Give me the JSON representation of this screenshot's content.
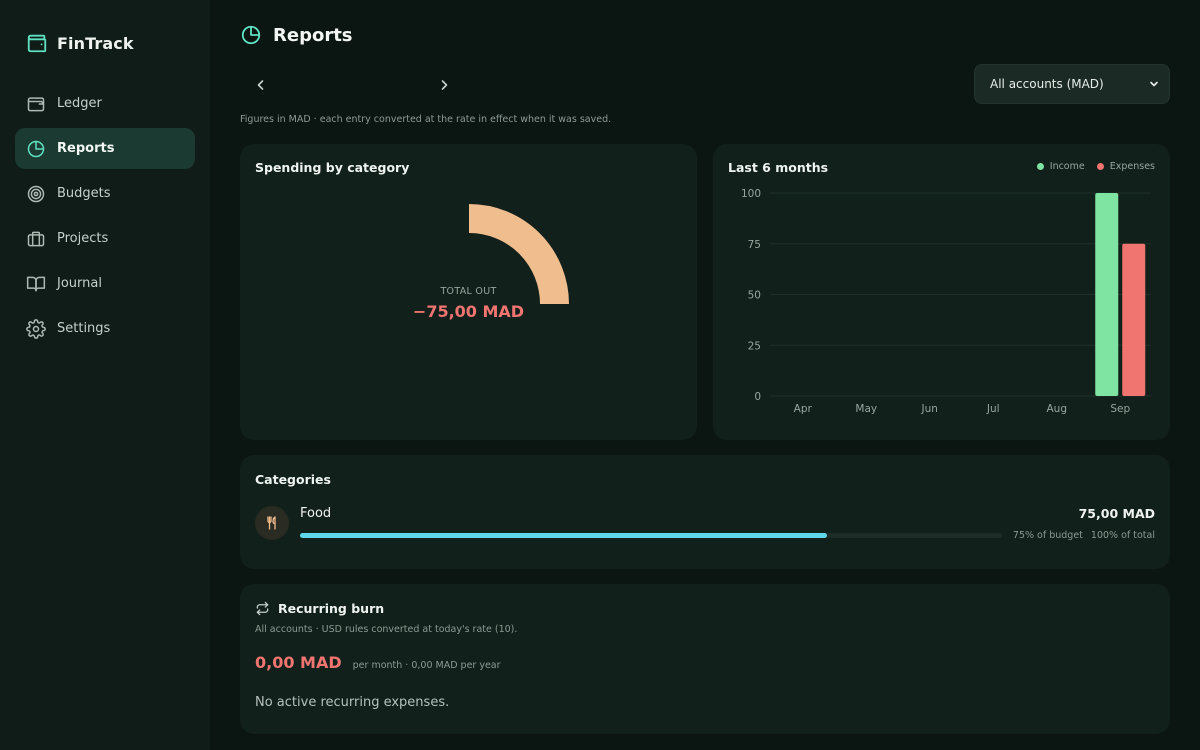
{
  "app": {
    "name": "FinTrack"
  },
  "sidebar": {
    "items": [
      {
        "label": "Ledger",
        "icon": "wallet-icon",
        "active": false
      },
      {
        "label": "Reports",
        "icon": "pie-chart-icon",
        "active": true
      },
      {
        "label": "Budgets",
        "icon": "target-icon",
        "active": false
      },
      {
        "label": "Projects",
        "icon": "briefcase-icon",
        "active": false
      },
      {
        "label": "Journal",
        "icon": "book-icon",
        "active": false
      },
      {
        "label": "Settings",
        "icon": "gear-icon",
        "active": false
      }
    ]
  },
  "header": {
    "title": "Reports"
  },
  "filters": {
    "account_select": "All accounts (MAD)",
    "note": "Figures in MAD · each entry converted at the rate in effect when it was saved."
  },
  "spending": {
    "title": "Spending by category",
    "total_label": "TOTAL OUT",
    "total_value": "−75,00 MAD",
    "slices": [
      {
        "name": "Food",
        "share": 1.0,
        "color": "#f0bd8e"
      }
    ]
  },
  "colors": {
    "income": "#7fe3a1",
    "expenses": "#f07470",
    "accent": "#5fd7ea",
    "sidebar_active": "#1b3a31"
  },
  "chart_data": {
    "type": "bar",
    "title": "Last 6 months",
    "categories": [
      "Apr",
      "May",
      "Jun",
      "Jul",
      "Aug",
      "Sep"
    ],
    "series": [
      {
        "name": "Income",
        "values": [
          0,
          0,
          0,
          0,
          0,
          100
        ]
      },
      {
        "name": "Expenses",
        "values": [
          0,
          0,
          0,
          0,
          0,
          75
        ]
      }
    ],
    "yticks": [
      0,
      25,
      50,
      75,
      100
    ],
    "ylim": [
      0,
      100
    ],
    "grid": true,
    "legend": "top-right"
  },
  "categories_card": {
    "title": "Categories",
    "items": [
      {
        "name": "Food",
        "icon": "fork-knife-icon",
        "amount": "75,00 MAD",
        "progress": 0.75,
        "budget_text": "75% of budget",
        "total_text": "100% of total"
      }
    ]
  },
  "recurring": {
    "title": "Recurring burn",
    "note": "All accounts · USD rules converted at today's rate (10).",
    "amount": "0,00 MAD",
    "per_text": "per month · 0,00 MAD per year",
    "empty_text": "No active recurring expenses."
  }
}
